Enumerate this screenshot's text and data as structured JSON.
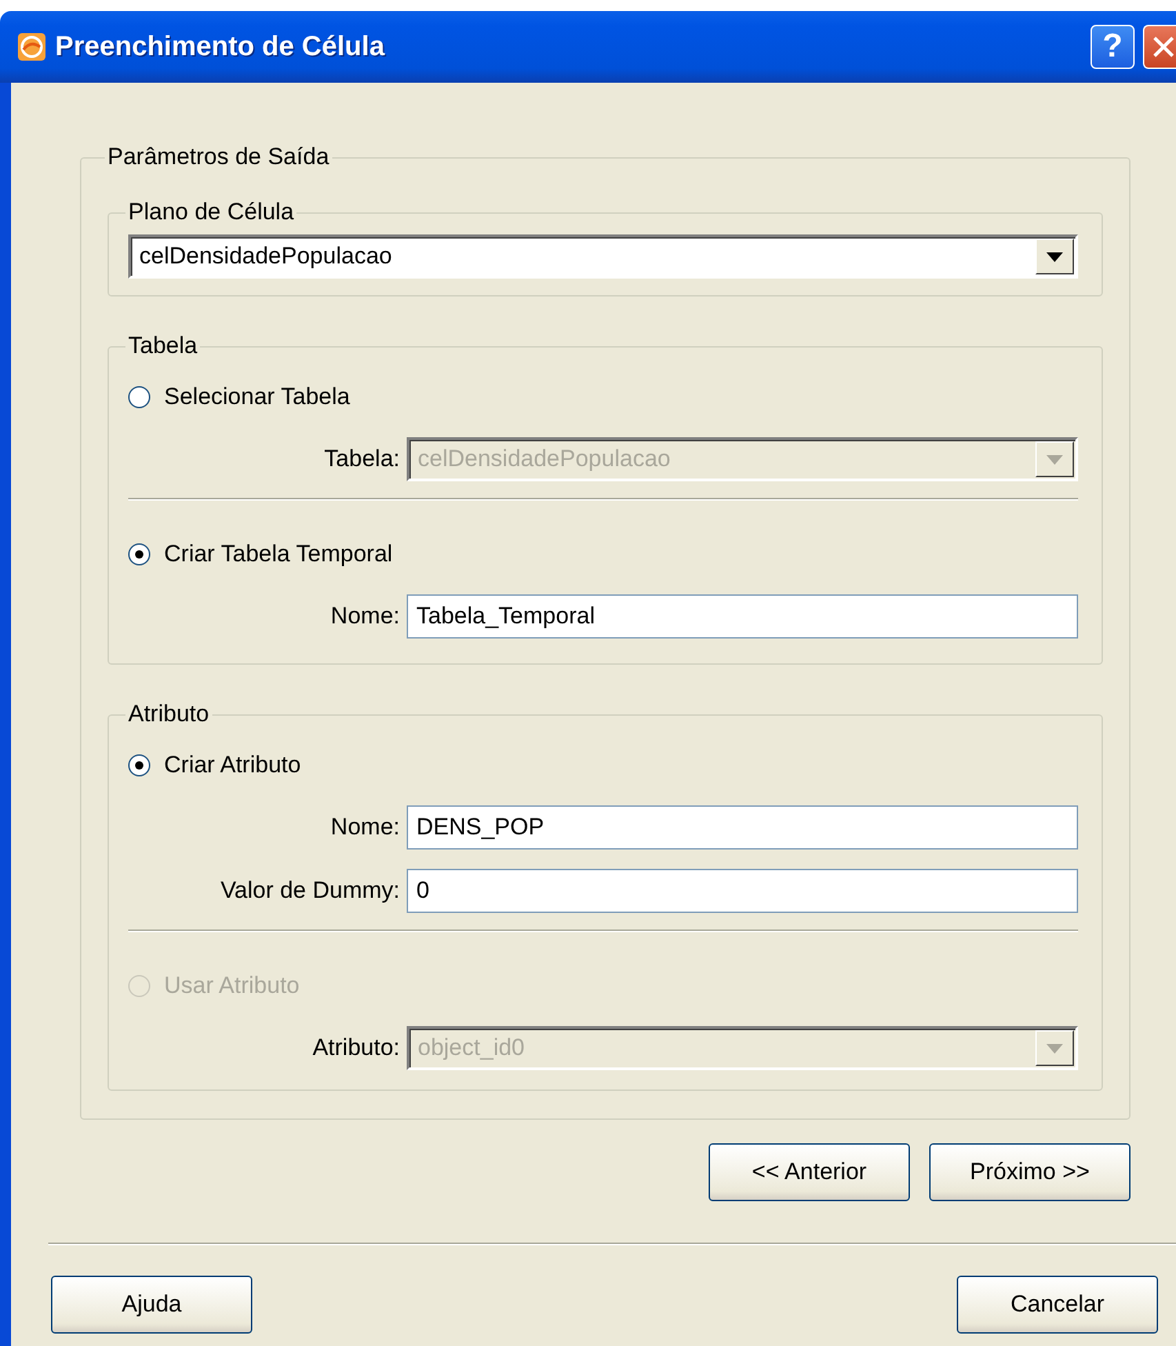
{
  "window": {
    "title": "Preenchimento de Célula",
    "help_button": "?"
  },
  "output_group": {
    "title": "Parâmetros de Saída",
    "plan_group": {
      "title": "Plano de Célula",
      "combo": {
        "value": "celDensidadePopulacao",
        "disabled": false
      }
    },
    "table_group": {
      "title": "Tabela",
      "sections": [
        {
          "radio": {
            "label": "Selecionar Tabela",
            "selected": false,
            "disabled": false
          },
          "fields": [
            {
              "kind": "combo",
              "label": "Tabela:",
              "value": "celDensidadePopulacao",
              "disabled": true
            }
          ]
        },
        {
          "radio": {
            "label": "Criar Tabela Temporal",
            "selected": true,
            "disabled": false
          },
          "fields": [
            {
              "kind": "text",
              "label": "Nome:",
              "value": "Tabela_Temporal",
              "disabled": false
            }
          ]
        }
      ]
    },
    "attribute_group": {
      "title": "Atributo",
      "sections": [
        {
          "radio": {
            "label": "Criar Atributo",
            "selected": true,
            "disabled": false
          },
          "fields": [
            {
              "kind": "text",
              "label": "Nome:",
              "value": "DENS_POP",
              "disabled": false
            },
            {
              "kind": "text",
              "label": "Valor de Dummy:",
              "value": "0",
              "disabled": false
            }
          ]
        },
        {
          "radio": {
            "label": "Usar Atributo",
            "selected": false,
            "disabled": true
          },
          "fields": [
            {
              "kind": "combo",
              "label": "Atributo:",
              "value": "object_id0",
              "disabled": true
            }
          ]
        }
      ]
    }
  },
  "nav_buttons": [
    "<< Anterior",
    "Próximo >>"
  ],
  "footer_buttons": [
    "Ajuda",
    "Cancelar"
  ]
}
